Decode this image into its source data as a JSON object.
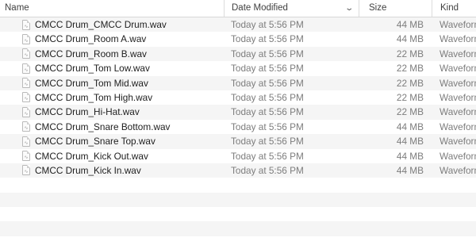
{
  "columns": {
    "name": "Name",
    "date_modified": "Date Modified",
    "size": "Size",
    "kind": "Kind"
  },
  "sort_indicator_icon": "chevron-down-icon",
  "file_icon": "audio-file-icon",
  "files": [
    {
      "name": "CMCC Drum_CMCC Drum.wav",
      "date": "Today at 5:56 PM",
      "size": "44 MB",
      "kind": "Waveform"
    },
    {
      "name": "CMCC Drum_Room A.wav",
      "date": "Today at 5:56 PM",
      "size": "44 MB",
      "kind": "Waveform"
    },
    {
      "name": "CMCC Drum_Room B.wav",
      "date": "Today at 5:56 PM",
      "size": "22 MB",
      "kind": "Waveform"
    },
    {
      "name": "CMCC Drum_Tom Low.wav",
      "date": "Today at 5:56 PM",
      "size": "22 MB",
      "kind": "Waveform"
    },
    {
      "name": "CMCC Drum_Tom Mid.wav",
      "date": "Today at 5:56 PM",
      "size": "22 MB",
      "kind": "Waveform"
    },
    {
      "name": "CMCC Drum_Tom High.wav",
      "date": "Today at 5:56 PM",
      "size": "22 MB",
      "kind": "Waveform"
    },
    {
      "name": "CMCC Drum_Hi-Hat.wav",
      "date": "Today at 5:56 PM",
      "size": "22 MB",
      "kind": "Waveform"
    },
    {
      "name": "CMCC Drum_Snare Bottom.wav",
      "date": "Today at 5:56 PM",
      "size": "44 MB",
      "kind": "Waveform"
    },
    {
      "name": "CMCC Drum_Snare Top.wav",
      "date": "Today at 5:56 PM",
      "size": "44 MB",
      "kind": "Waveform"
    },
    {
      "name": "CMCC Drum_Kick Out.wav",
      "date": "Today at 5:56 PM",
      "size": "44 MB",
      "kind": "Waveform"
    },
    {
      "name": "CMCC Drum_Kick In.wav",
      "date": "Today at 5:56 PM",
      "size": "44 MB",
      "kind": "Waveform"
    }
  ]
}
